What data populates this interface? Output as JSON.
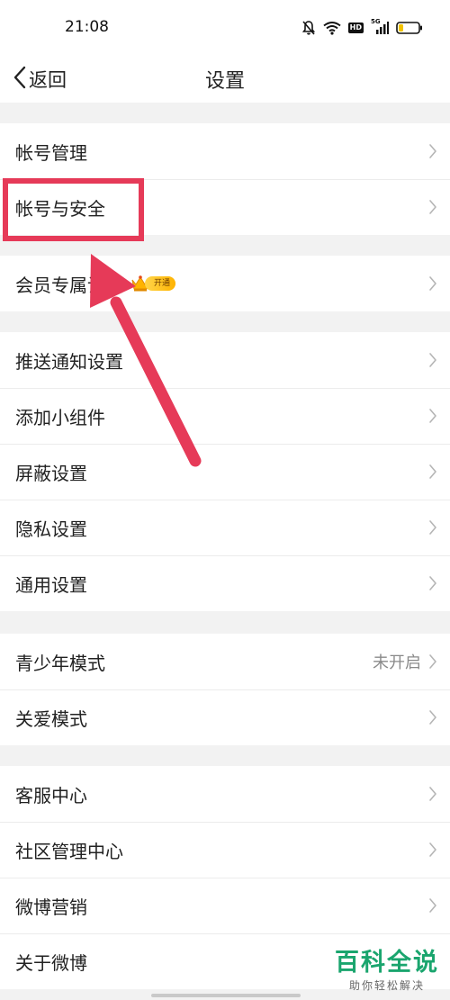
{
  "status_bar": {
    "time": "21:08",
    "icons": [
      "mute-bell-icon",
      "wifi-icon",
      "hd-icon",
      "signal-5g-icon",
      "battery-icon"
    ],
    "hd_text": "HD",
    "network_text": "5G"
  },
  "nav": {
    "back_label": "返回",
    "title": "设置"
  },
  "sections": [
    {
      "items": [
        {
          "label": "帐号管理"
        },
        {
          "label": "帐号与安全"
        }
      ]
    },
    {
      "items": [
        {
          "label": "会员专属设置",
          "badge": "开通"
        }
      ]
    },
    {
      "items": [
        {
          "label": "推送通知设置"
        },
        {
          "label": "添加小组件"
        },
        {
          "label": "屏蔽设置"
        },
        {
          "label": "隐私设置"
        },
        {
          "label": "通用设置"
        }
      ]
    },
    {
      "items": [
        {
          "label": "青少年模式",
          "value": "未开启"
        },
        {
          "label": "关爱模式"
        }
      ]
    },
    {
      "items": [
        {
          "label": "客服中心"
        },
        {
          "label": "社区管理中心"
        },
        {
          "label": "微博营销"
        },
        {
          "label": "关于微博"
        }
      ]
    }
  ],
  "watermark": {
    "title": "百科全说",
    "subtitle": "助你轻松解决"
  },
  "colors": {
    "background": "#f2f2f2",
    "highlight": "#e63a58",
    "watermark": "#1aa56e",
    "vip_gold": "#ffb300"
  }
}
